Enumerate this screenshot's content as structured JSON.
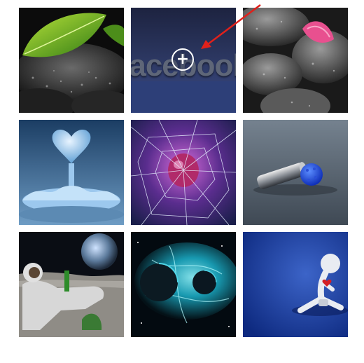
{
  "gallery": {
    "tiles": [
      {
        "subject": "green-leaf-on-wet-stones"
      },
      {
        "subject": "facebook-logo-text",
        "overlay_text": "acebool",
        "hover_icon": "plus-circle-icon",
        "zoom_symbol": "+"
      },
      {
        "subject": "pink-petal-on-black-stones"
      },
      {
        "subject": "water-heart-splash"
      },
      {
        "subject": "broken-glass-apple-logo"
      },
      {
        "subject": "metal-cylinder-and-blue-sphere"
      },
      {
        "subject": "astronaut-on-moon-with-earth"
      },
      {
        "subject": "cyan-nebula-planets"
      },
      {
        "subject": "white-figure-with-red-heart"
      }
    ]
  },
  "annotation": {
    "color": "#e0211b",
    "icon": "red-arrow-icon"
  }
}
